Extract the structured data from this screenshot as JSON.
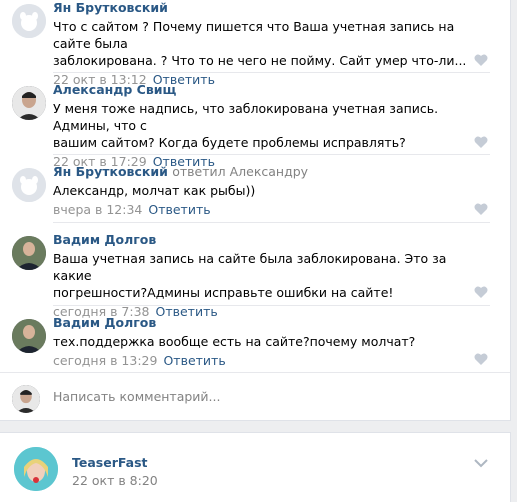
{
  "comments": [
    {
      "author": "Ян Брутковский",
      "replied_to": "",
      "text_lines": [
        "Что с сайтом ? Почему пишется что Ваша учетная запись на сайте была",
        "заблокирована. ? Что то не чего не пойму. Сайт умер что-ли..."
      ],
      "time": "22 окт в 13:12",
      "reply": "Ответить"
    },
    {
      "author": "Александр Свищ",
      "replied_to": "",
      "text_lines": [
        "У меня тоже надпись, что заблокирована учетная запись. Админы, что с",
        "вашим сайтом? Когда будете проблемы исправлять?"
      ],
      "time": "22 окт в 17:29",
      "reply": "Ответить"
    },
    {
      "author": "Ян Брутковский",
      "replied_to": "ответил Александру",
      "text_lines": [
        "Александр, молчат как рыбы))"
      ],
      "time": "вчера в 12:34",
      "reply": "Ответить"
    },
    {
      "author": "Вадим Долгов",
      "replied_to": "",
      "text_lines": [
        "Ваша учетная запись на сайте была заблокирована. Это за какие",
        "погрешности?Админы исправьте ошибки на сайте!"
      ],
      "time": "сегодня в 7:38",
      "reply": "Ответить"
    },
    {
      "author": "Вадим Долгов",
      "replied_to": "",
      "text_lines": [
        "тех.поддержка вообще есть на сайте?почему молчат?"
      ],
      "time": "сегодня в 13:29",
      "reply": "Ответить"
    }
  ],
  "reply_box": {
    "placeholder": "Написать комментарий..."
  },
  "post": {
    "name": "TeaserFast",
    "date": "22 окт в 8:20"
  },
  "colors": {
    "link": "#2a5885",
    "meta": "#939393",
    "background": "#edeef0"
  }
}
